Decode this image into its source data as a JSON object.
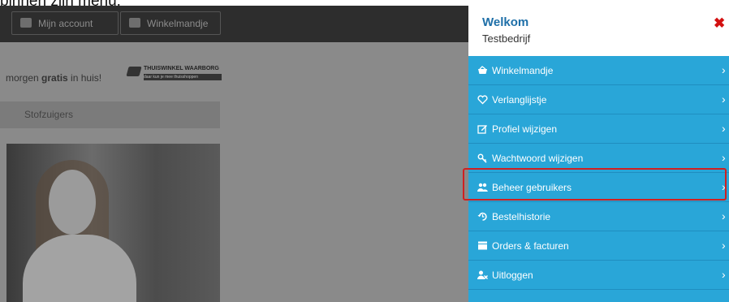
{
  "caption": "binnen zijn menu:",
  "site": {
    "account_button": "Mijn account",
    "cart_button": "Winkelmandje",
    "promo_prefix": "morgen ",
    "promo_bold": "gratis",
    "promo_suffix": " in huis!",
    "badge_title": "THUISWINKEL WAARBORG",
    "badge_sub": "daar kun je mee thuisshoppen",
    "breadcrumb": "Stofzuigers"
  },
  "panel": {
    "welcome": "Welkom",
    "company": "Testbedrijf",
    "close_glyph": "✖",
    "chevron_glyph": "›",
    "menu": [
      {
        "label": "Winkelmandje",
        "icon": "basket-icon"
      },
      {
        "label": "Verlanglijstje",
        "icon": "heart-icon"
      },
      {
        "label": "Profiel wijzigen",
        "icon": "edit-icon"
      },
      {
        "label": "Wachtwoord wijzigen",
        "icon": "key-icon"
      },
      {
        "label": "Beheer gebruikers",
        "icon": "users-icon",
        "highlighted": true
      },
      {
        "label": "Bestelhistorie",
        "icon": "history-icon"
      },
      {
        "label": "Orders & facturen",
        "icon": "invoice-icon"
      },
      {
        "label": "Uitloggen",
        "icon": "logout-icon"
      }
    ]
  },
  "colors": {
    "panel": "#29a6d8",
    "highlight_border": "#d02020",
    "close": "#d31010",
    "welcome": "#1e6fa8"
  }
}
